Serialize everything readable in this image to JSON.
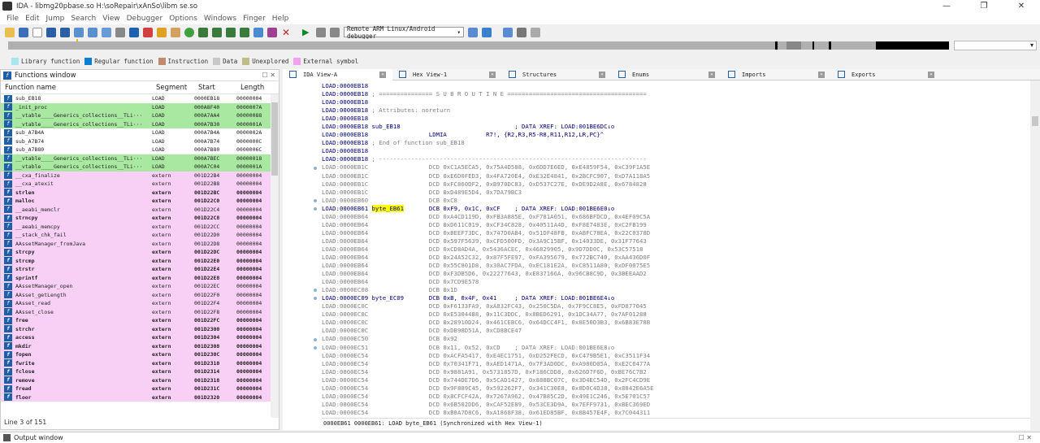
{
  "window": {
    "title": "IDA - libmg20pbase.so H:\\soRepair\\xAnSo\\libm        se.so",
    "minimize": "—",
    "maximize": "❐",
    "close": "✕"
  },
  "menu": [
    "File",
    "Edit",
    "Jump",
    "Search",
    "View",
    "Debugger",
    "Options",
    "Windows",
    "Finger",
    "Help"
  ],
  "toolbar": {
    "debugger_label": "Remote ARM Linux/Android debugger"
  },
  "legend": [
    {
      "label": "Library function",
      "color": "#a8e4f0"
    },
    {
      "label": "Regular function",
      "color": "#0a7ecf"
    },
    {
      "label": "Instruction",
      "color": "#c08a70"
    },
    {
      "label": "Data",
      "color": "#c8c8c8"
    },
    {
      "label": "Unexplored",
      "color": "#bdbd88"
    },
    {
      "label": "External symbol",
      "color": "#f4a0f0"
    }
  ],
  "functions_window": {
    "title": "Functions window",
    "columns": [
      "Function name",
      "Segment",
      "Start",
      "Length"
    ],
    "status": "Line 3 of 151",
    "rows": [
      {
        "name": "sub_EB18",
        "seg": "LOAD",
        "start": "0000EB18",
        "len": "00000004",
        "style": ""
      },
      {
        "name": "_init_proc",
        "seg": "LOAD",
        "start": "000A8F40",
        "len": "0000007A",
        "style": "green"
      },
      {
        "name": "__vtable____Generics_collections__TLi···",
        "seg": "LOAD",
        "start": "000A7AA4",
        "len": "00000088",
        "style": "green"
      },
      {
        "name": "__vtable____Generics_collections__TLi···",
        "seg": "LOAD",
        "start": "000A7B30",
        "len": "0000001A",
        "style": "green"
      },
      {
        "name": "sub_A7B4A",
        "seg": "LOAD",
        "start": "000A7B4A",
        "len": "0000002A",
        "style": ""
      },
      {
        "name": "sub_A7B74",
        "seg": "LOAD",
        "start": "000A7B74",
        "len": "0000000C",
        "style": ""
      },
      {
        "name": "sub_A7B80",
        "seg": "LOAD",
        "start": "000A7B80",
        "len": "0000006C",
        "style": ""
      },
      {
        "name": "__vtable____Generics_collections__TLi···",
        "seg": "LOAD",
        "start": "000A7BEC",
        "len": "00000018",
        "style": "green"
      },
      {
        "name": "__vtable____Generics_collections__TLi···",
        "seg": "LOAD",
        "start": "000A7C04",
        "len": "0000001A",
        "style": "green"
      },
      {
        "name": "__cxa_finalize",
        "seg": "extern",
        "start": "001D22B4",
        "len": "00000004",
        "style": "pink"
      },
      {
        "name": "__cxa_atexit",
        "seg": "extern",
        "start": "001D22B8",
        "len": "00000004",
        "style": "pink"
      },
      {
        "name": "strlen",
        "seg": "extern",
        "start": "001D22BC",
        "len": "00000004",
        "style": "pink bold"
      },
      {
        "name": "malloc",
        "seg": "extern",
        "start": "001D22C0",
        "len": "00000004",
        "style": "pink bold"
      },
      {
        "name": "__aeabi_memclr",
        "seg": "extern",
        "start": "001D22C4",
        "len": "00000004",
        "style": "pink"
      },
      {
        "name": "strncpy",
        "seg": "extern",
        "start": "001D22C8",
        "len": "00000004",
        "style": "pink bold"
      },
      {
        "name": "__aeabi_memcpy",
        "seg": "extern",
        "start": "001D22CC",
        "len": "00000004",
        "style": "pink"
      },
      {
        "name": "__stack_chk_fail",
        "seg": "extern",
        "start": "001D22D0",
        "len": "00000004",
        "style": "pink"
      },
      {
        "name": "AAssetManager_fromJava",
        "seg": "extern",
        "start": "001D22D8",
        "len": "00000004",
        "style": "pink"
      },
      {
        "name": "strcpy",
        "seg": "extern",
        "start": "001D22DC",
        "len": "00000004",
        "style": "pink bold"
      },
      {
        "name": "strcmp",
        "seg": "extern",
        "start": "001D22E0",
        "len": "00000004",
        "style": "pink bold"
      },
      {
        "name": "strstr",
        "seg": "extern",
        "start": "001D22E4",
        "len": "00000004",
        "style": "pink bold"
      },
      {
        "name": "sprintf",
        "seg": "extern",
        "start": "001D22E8",
        "len": "00000004",
        "style": "pink bold"
      },
      {
        "name": "AAssetManager_open",
        "seg": "extern",
        "start": "001D22EC",
        "len": "00000004",
        "style": "pink"
      },
      {
        "name": "AAsset_getLength",
        "seg": "extern",
        "start": "001D22F0",
        "len": "00000004",
        "style": "pink"
      },
      {
        "name": "AAsset_read",
        "seg": "extern",
        "start": "001D22F4",
        "len": "00000004",
        "style": "pink"
      },
      {
        "name": "AAsset_close",
        "seg": "extern",
        "start": "001D22F8",
        "len": "00000004",
        "style": "pink"
      },
      {
        "name": "free",
        "seg": "extern",
        "start": "001D22FC",
        "len": "00000004",
        "style": "pink bold"
      },
      {
        "name": "strchr",
        "seg": "extern",
        "start": "001D2300",
        "len": "00000004",
        "style": "pink bold"
      },
      {
        "name": "access",
        "seg": "extern",
        "start": "001D2304",
        "len": "00000004",
        "style": "pink bold"
      },
      {
        "name": "mkdir",
        "seg": "extern",
        "start": "001D2308",
        "len": "00000004",
        "style": "pink bold"
      },
      {
        "name": "fopen",
        "seg": "extern",
        "start": "001D230C",
        "len": "00000004",
        "style": "pink bold"
      },
      {
        "name": "fwrite",
        "seg": "extern",
        "start": "001D2310",
        "len": "00000004",
        "style": "pink bold"
      },
      {
        "name": "fclose",
        "seg": "extern",
        "start": "001D2314",
        "len": "00000004",
        "style": "pink bold"
      },
      {
        "name": "remove",
        "seg": "extern",
        "start": "001D2318",
        "len": "00000004",
        "style": "pink bold"
      },
      {
        "name": "fread",
        "seg": "extern",
        "start": "001D231C",
        "len": "00000004",
        "style": "pink bold"
      },
      {
        "name": "floor",
        "seg": "extern",
        "start": "001D2320",
        "len": "00000004",
        "style": "pink bold"
      }
    ]
  },
  "tabs": [
    {
      "label": "IDA View-A",
      "active": true
    },
    {
      "label": "Hex View-1",
      "active": false
    },
    {
      "label": "Structures",
      "active": false
    },
    {
      "label": "Enums",
      "active": false
    },
    {
      "label": "Imports",
      "active": false
    },
    {
      "label": "Exports",
      "active": false
    }
  ],
  "listing": [
    {
      "a": "LOAD:0000EB18",
      "t": "",
      "g": false
    },
    {
      "a": "LOAD:0000EB18",
      "t": " ; =============== S U B R O U T I N E =======================================",
      "g": false,
      "c": true
    },
    {
      "a": "LOAD:0000EB18",
      "t": "",
      "g": false
    },
    {
      "a": "LOAD:0000EB18",
      "t": " ; Attributes: noreturn",
      "g": false,
      "c": true
    },
    {
      "a": "LOAD:0000EB18",
      "t": "",
      "g": false
    },
    {
      "a": "LOAD:0000EB18",
      "t": " sub_EB18                                ; DATA XREF: LOAD:001BE6DC↓o",
      "g": false
    },
    {
      "a": "LOAD:0000EB18",
      "t": "                 LDMIA           R7!, {R2,R3,R5-R8,R11,R12,LR,PC}^",
      "g": false
    },
    {
      "a": "LOAD:0000EB18",
      "t": " ; End of function sub_EB18",
      "g": false,
      "c": true
    },
    {
      "a": "LOAD:0000EB18",
      "t": "",
      "g": false
    },
    {
      "a": "LOAD:0000EB18",
      "t": " ; ---------------------------------------------------------------------------",
      "g": false,
      "c": true
    },
    {
      "a": "LOAD:0000EB1C",
      "t": "                 DCD 0xC1A5ECA5, 0x75A4D588, 0x6DD7E6ED, 0xE4859F54, 0xC39F1A5E",
      "g": true
    },
    {
      "a": "LOAD:0000EB1C",
      "t": "                 DCD 0xE6D0FED3, 0x4FA720E4, 0xE32E4841, 0x2BCFC907, 0xD7A118A5",
      "g": true
    },
    {
      "a": "LOAD:0000EB1C",
      "t": "                 DCD 0xFC860DF2, 0xB970DC83, 0xD537C27E, 0xDE9D2A8E, 0x6784828",
      "g": true
    },
    {
      "a": "LOAD:0000EB1C",
      "t": "                 DCD 0xD489E5D4, 0x7DA79BC3",
      "g": true
    },
    {
      "a": "LOAD:0000EB60",
      "t": "                 DCB 0xC8",
      "g": true
    },
    {
      "a": "LOAD:0000EB61",
      "t": " byte_EB61       DCB 0xF9, 0x1C, 0xCF    ; DATA XREF: LOAD:001BE6E0↓o",
      "g": false,
      "hl": "byte_EB61"
    },
    {
      "a": "LOAD:0000EB64",
      "t": "                 DCD 0xA4CD119D, 0xFB3A885E, 0xF781A051, 0x686BFDCD, 0x4EF09C5A",
      "g": true
    },
    {
      "a": "LOAD:0000EB64",
      "t": "                 DCD 0xD611C019, 0xCF34C828, 0x40511A4D, 0xF8E7483E, 0xC2FB199",
      "g": true
    },
    {
      "a": "LOAD:0000EB64",
      "t": "                 DCD 0xBEEF73DC, 0x747D0AB4, 0x51DF48FB, 0xABFC78EA, 0x22C0378D",
      "g": true
    },
    {
      "a": "LOAD:0000EB64",
      "t": "                 DCD 0x597F5639, 0xCFD500FD, 0x3A9C15BF, 0x14033DE, 0x31F77643",
      "g": true
    },
    {
      "a": "LOAD:0000EB64",
      "t": "                 DCD 0xCD8AD4A, 0x5436ACEC, 0x46829905, 0x9D7DD0C, 0x53C57518",
      "g": true
    },
    {
      "a": "LOAD:0000EB64",
      "t": "                 DCD 0x24A52C32, 0x87F5FE97, 0xFA395679, 0x772BC740, 0xAA436D0F",
      "g": true
    },
    {
      "a": "LOAD:0000EB64",
      "t": "                 DCD 0x55C801D8, 0x30AC7FDA, 0xEC181E2A, 0xC8511A80, 0xDF0075E5",
      "g": true
    },
    {
      "a": "LOAD:0000EB64",
      "t": "                 DCD 0xF3DB5D6, 0x22277643, 0xE837166A, 0x96CB8C9D, 0x3BEEAAD2",
      "g": true
    },
    {
      "a": "LOAD:0000EB64",
      "t": "                 DCD 0x7CD9E578",
      "g": true
    },
    {
      "a": "LOAD:0000EC08",
      "t": "                 DCB 0x1D",
      "g": true
    },
    {
      "a": "LOAD:0000EC09",
      "t": " byte_EC09       DCB 0xB, 0x4F, 0x41     ; DATA XREF: LOAD:001BE6E4↓o",
      "g": false
    },
    {
      "a": "LOAD:0000EC0C",
      "t": "                 DCD 0xF6133FA9, 0xA832FC43, 0x250C5DA, 0x7F9CC8E5, 0xFD877045",
      "g": true
    },
    {
      "a": "LOAD:0000EC0C",
      "t": "                 DCD 0xE5304488, 0x11C3DDC, 0x8BED6291, 0x1DC34A77, 0x7AF01288",
      "g": true
    },
    {
      "a": "LOAD:0000EC0C",
      "t": "                 DCD 0x28910D24, 0x461CEBC6, 0x64DCC4F1, 0x8E50D3B3, 0x6B83E78B",
      "g": true
    },
    {
      "a": "LOAD:0000EC0C",
      "t": "                 DCD 0xDB98D51A, 0xCD8BCE47",
      "g": true
    },
    {
      "a": "LOAD:0000EC50",
      "t": "                 DCB 0x92",
      "g": true
    },
    {
      "a": "LOAD:0000EC51",
      "t": "                 DCB 0x11, 0x52, 0xCD    ; DATA XREF: LOAD:001BE6E8↓o",
      "g": true
    },
    {
      "a": "LOAD:0000EC54",
      "t": "                 DCD 0xACFA5417, 0xE4EC1751, 0xD252FECD, 0xC479B5E1, 0xC3511F34",
      "g": true
    },
    {
      "a": "LOAD:0000EC54",
      "t": "                 DCD 0x70341F71, 0xAED1471A, 0x7F3AD0DC, 0xA980D05A, 0xE2C6477A",
      "g": true
    },
    {
      "a": "LOAD:0000EC54",
      "t": "                 DCD 0x9881A91, 0x5731857D, 0xF186CDD8, 0x626D7F6D, 0xBE76C7B2",
      "g": true
    },
    {
      "a": "LOAD:0000EC54",
      "t": "                 DCD 0x744DE7D6, 0x5CAD1427, 0x888BC07C, 0x3D4EC54D, 0x2FC4CD9E",
      "g": true
    },
    {
      "a": "LOAD:0000EC54",
      "t": "                 DCD 0x9F889C45, 0x592262F7, 0x341C30E8, 0x8D0C4D38, 0x8842E6A5E",
      "g": true
    },
    {
      "a": "LOAD:0000EC54",
      "t": "                 DCD 0x8CFCF42A, 0x7267A962, 0x47B85C2D, 0x49E1C246, 0x5E701C57",
      "g": true
    },
    {
      "a": "LOAD:0000EC54",
      "t": "                 DCD 0x6B502DD6, 0xCAF52E89, 0x53CE3D9A, 0x7EFF9731, 0xBEC369ED",
      "g": true
    },
    {
      "a": "LOAD:0000EC54",
      "t": "                 DCD 0xB0A7D8C6, 0xA1868F38, 0x61ED85BF, 0x8B457E4F, 0x7C044311",
      "g": true
    }
  ],
  "view_status": "0000EB61 0000EB61: LOAD byte_EB61 (Synchronized with Hex View-1)",
  "output": {
    "label": "Output window"
  }
}
